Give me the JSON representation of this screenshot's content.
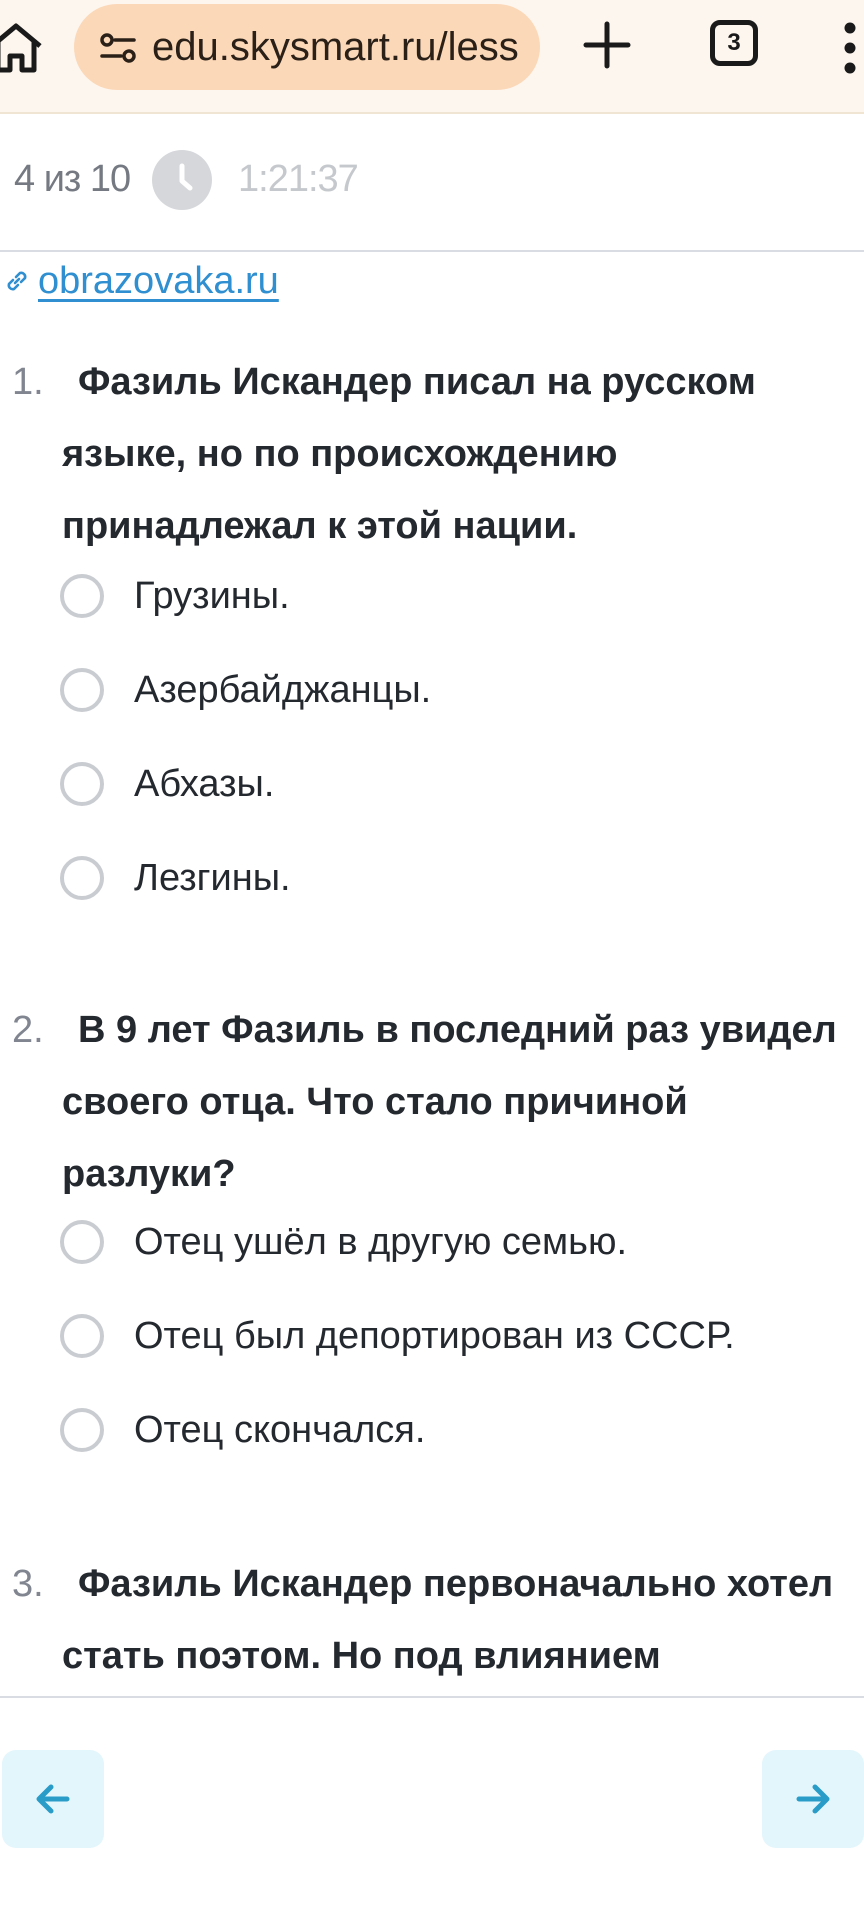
{
  "browser": {
    "url": "edu.skysmart.ru/less",
    "tab_count": "3"
  },
  "progress": {
    "text": "4 из 10",
    "timer": "1:21:37"
  },
  "source_link": "obrazovaka.ru",
  "questions": [
    {
      "number": "1.",
      "text": "Фазиль Искандер писал на русском языке, но по происхождению принадлежал к этой нации.",
      "options": [
        "Грузины.",
        "Азербайджанцы.",
        "Абхазы.",
        "Лезгины."
      ]
    },
    {
      "number": "2.",
      "text": "В 9 лет Фазиль в последний раз увидел своего отца. Что стало причиной разлуки?",
      "options": [
        "Отец ушёл в другую семью.",
        "Отец был депортирован из СССР.",
        "Отец скончался."
      ]
    },
    {
      "number": "3.",
      "text": "Фазиль Искандер первоначально хотел стать поэтом. Но под влиянием"
    }
  ],
  "colors": {
    "accent": "#2f8fd0",
    "nav_button_bg": "#e3f6fb",
    "nav_arrow": "#2a9cc8"
  }
}
